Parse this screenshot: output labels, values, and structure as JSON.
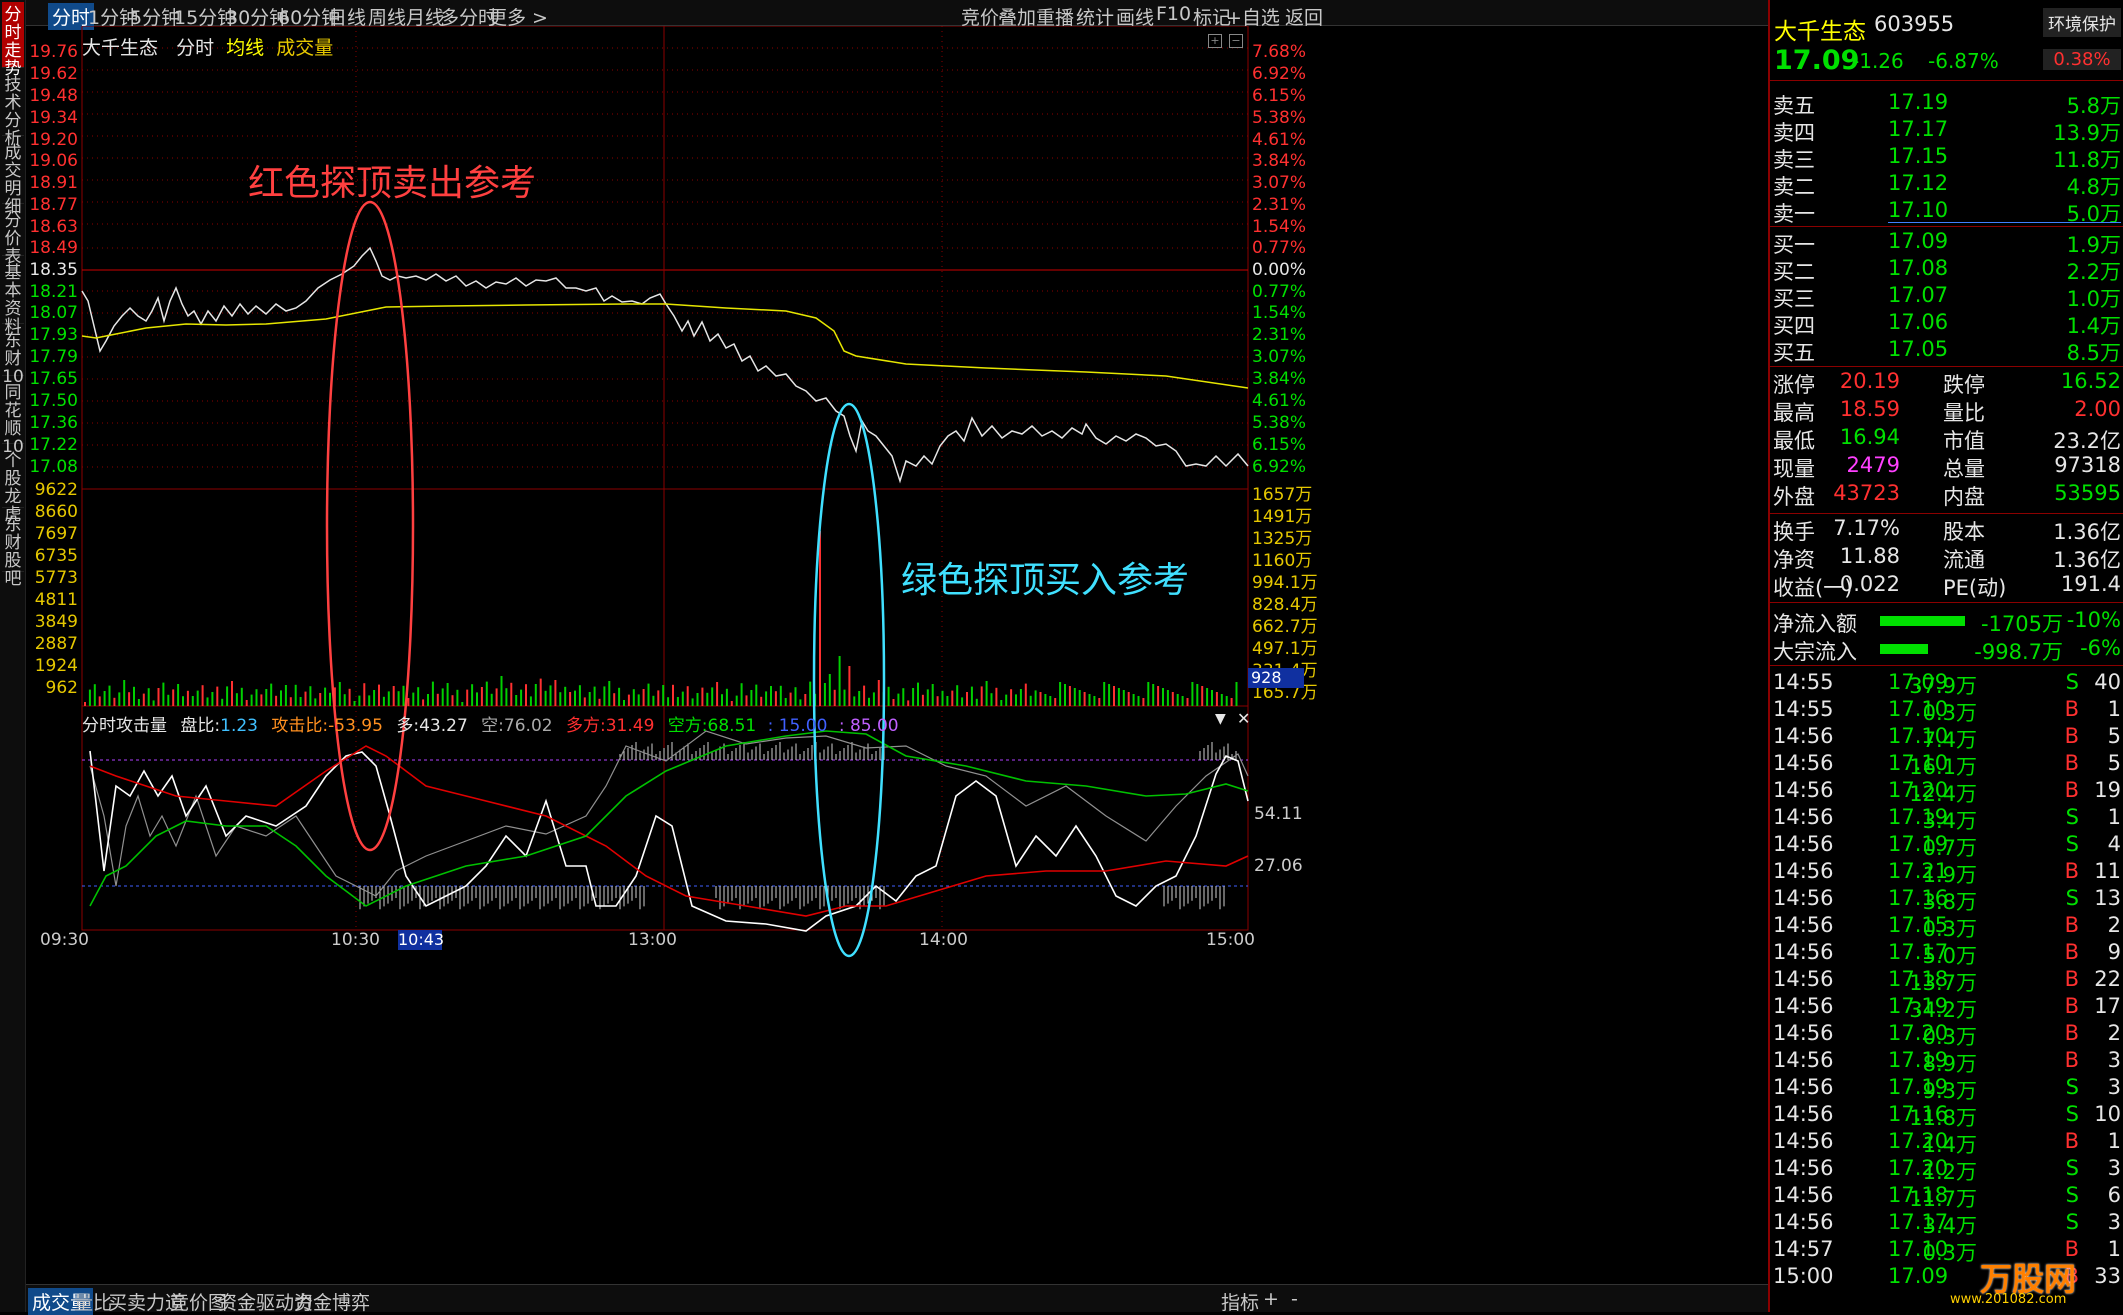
{
  "leftnav": [
    "分时走势",
    "技术分析",
    "成交明细",
    "分价表",
    "基本资料",
    "东财10",
    "同花顺10",
    "个股龙虎",
    "东财股吧"
  ],
  "topbar": {
    "tabs": [
      "分时",
      "1分钟",
      "5分钟",
      "15分钟",
      "30分钟",
      "60分钟",
      "日线",
      "周线",
      "月线",
      "多分时",
      "更多 >"
    ],
    "right": [
      "竞价",
      "叠加",
      "重播",
      "统计",
      "画线",
      "F10",
      "标记",
      "+自选",
      "返回"
    ]
  },
  "header": {
    "name": "大千生态",
    "mode": "分时",
    "avg": "均线",
    "vol": "成交量"
  },
  "price_axis": [
    "19.76",
    "19.62",
    "19.48",
    "19.34",
    "19.20",
    "19.06",
    "18.91",
    "18.77",
    "18.63",
    "18.49",
    "18.35",
    "18.21",
    "18.07",
    "17.93",
    "17.79",
    "17.65",
    "17.50",
    "17.36",
    "17.22",
    "17.08"
  ],
  "pct_axis": [
    "7.68%",
    "6.92%",
    "6.15%",
    "5.38%",
    "4.61%",
    "3.84%",
    "3.07%",
    "2.31%",
    "1.54%",
    "0.77%",
    "0.00%",
    "0.77%",
    "1.54%",
    "2.31%",
    "3.07%",
    "3.84%",
    "4.61%",
    "5.38%",
    "6.15%",
    "6.92%"
  ],
  "vol_axis": [
    "9622",
    "8660",
    "7697",
    "6735",
    "5773",
    "4811",
    "3849",
    "2887",
    "1924",
    "962"
  ],
  "vol_axis_r": [
    "1657万",
    "1491万",
    "1325万",
    "1160万",
    "994.1万",
    "828.4万",
    "662.7万",
    "497.1万",
    "331.4万",
    "165.7万"
  ],
  "vol_cursor": "928",
  "ind": {
    "title": "分时攻击量",
    "pb_label": "盘比:",
    "pb": "1.23",
    "gj_label": "攻击比:",
    "gj": "-53.95",
    "duo_label": "多:",
    "duo": "43.27",
    "kong_label": "空:",
    "kong": "76.02",
    "df_label": "多方:",
    "df": "31.49",
    "kf_label": "空方:",
    "kf": "68.51",
    "l1": ": 15.00",
    "l2": ": 85.00",
    "r1": "54.11",
    "r2": "27.06"
  },
  "time_axis": [
    "09:30",
    "10:30",
    "13:00",
    "14:00",
    "15:00"
  ],
  "cursor_time": "10:43",
  "annotations": {
    "red": "红色探顶卖出参考",
    "cyan": "绿色探顶买入参考"
  },
  "bottom_tabs": [
    "成交量",
    "量比",
    "买卖力道",
    "竞价图",
    "资金驱动力",
    "资金博弈"
  ],
  "bottom_right": [
    "指标",
    "+",
    "-"
  ],
  "quote": {
    "name": "大千生态",
    "code": "603955",
    "tag": "环境保护",
    "price": "17.09",
    "chg": "-1.26",
    "pct": "-6.87%",
    "tag_pct": "0.38%",
    "asks": [
      [
        "卖五",
        "17.19",
        "5.8万"
      ],
      [
        "卖四",
        "17.17",
        "13.9万"
      ],
      [
        "卖三",
        "17.15",
        "11.8万"
      ],
      [
        "卖二",
        "17.12",
        "4.8万"
      ],
      [
        "卖一",
        "17.10",
        "5.0万"
      ]
    ],
    "bids": [
      [
        "买一",
        "17.09",
        "1.9万"
      ],
      [
        "买二",
        "17.08",
        "2.2万"
      ],
      [
        "买三",
        "17.07",
        "1.0万"
      ],
      [
        "买四",
        "17.06",
        "1.4万"
      ],
      [
        "买五",
        "17.05",
        "8.5万"
      ]
    ],
    "stats": [
      [
        "涨停",
        "20.19",
        "跌停",
        "16.52"
      ],
      [
        "最高",
        "18.59",
        "量比",
        "2.00"
      ],
      [
        "最低",
        "16.94",
        "市值",
        "23.2亿"
      ],
      [
        "现量",
        "2479",
        "总量",
        "97318"
      ],
      [
        "外盘",
        "43723",
        "内盘",
        "53595"
      ]
    ],
    "stats2": [
      [
        "换手",
        "7.17%",
        "股本",
        "1.36亿"
      ],
      [
        "净资",
        "11.88",
        "流通",
        "1.36亿"
      ],
      [
        "收益(一)",
        "0.022",
        "PE(动)",
        "191.4"
      ]
    ],
    "flow": [
      [
        "净流入额",
        "-1705万",
        "-10%"
      ],
      [
        "大宗流入",
        "-998.7万",
        "-6%"
      ]
    ],
    "trades": [
      [
        "14:55",
        "17.09",
        "37.9万",
        "S",
        "40"
      ],
      [
        "14:55",
        "17.10",
        "0.3万",
        "B",
        "1"
      ],
      [
        "14:56",
        "17.10",
        "7.4万",
        "B",
        "5"
      ],
      [
        "14:56",
        "17.10",
        "16.1万",
        "B",
        "5"
      ],
      [
        "14:56",
        "17.20",
        "12.4万",
        "B",
        "19"
      ],
      [
        "14:56",
        "17.19",
        "3.4万",
        "S",
        "1"
      ],
      [
        "14:56",
        "17.19",
        "0.7万",
        "S",
        "4"
      ],
      [
        "14:56",
        "17.21",
        "1.9万",
        "B",
        "11"
      ],
      [
        "14:56",
        "17.16",
        "3.8万",
        "S",
        "13"
      ],
      [
        "14:56",
        "17.15",
        "0.3万",
        "B",
        "2"
      ],
      [
        "14:56",
        "17.17",
        "5.0万",
        "B",
        "9"
      ],
      [
        "14:56",
        "17.18",
        "13.7万",
        "B",
        "22"
      ],
      [
        "14:56",
        "17.19",
        "34.2万",
        "B",
        "17"
      ],
      [
        "14:56",
        "17.20",
        "0.3万",
        "B",
        "2"
      ],
      [
        "14:56",
        "17.19",
        "8.9万",
        "B",
        "3"
      ],
      [
        "14:56",
        "17.19",
        "9.3万",
        "S",
        "3"
      ],
      [
        "14:56",
        "17.16",
        "11.8万",
        "S",
        "10"
      ],
      [
        "14:56",
        "17.20",
        "1.4万",
        "B",
        "1"
      ],
      [
        "14:56",
        "17.20",
        "1.2万",
        "S",
        "3"
      ],
      [
        "14:56",
        "17.18",
        "11.7万",
        "S",
        "6"
      ],
      [
        "14:56",
        "17.17",
        "3.4万",
        "S",
        "3"
      ],
      [
        "14:57",
        "17.10",
        "0.3万",
        "B",
        "1"
      ],
      [
        "15:00",
        "17.09",
        "",
        "B",
        "33"
      ]
    ],
    "watermark": "万股网",
    "watermark_url": "www.201082.com"
  },
  "colors": {
    "up": "#ff3030",
    "down": "#00e000",
    "avg": "#e6e600",
    "price": "#e6e6e6",
    "grid": "#8b0000",
    "cyan": "#40e0ff"
  }
}
